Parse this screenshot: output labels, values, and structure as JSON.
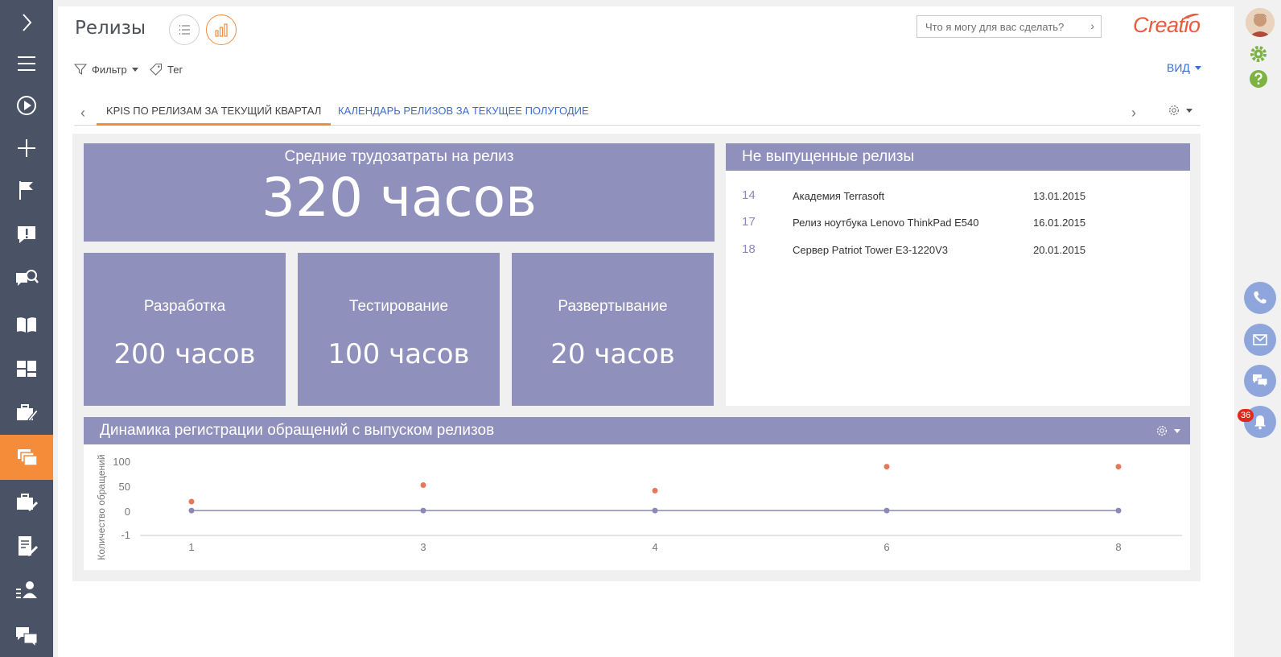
{
  "page": {
    "title": "Релизы"
  },
  "search": {
    "placeholder": "Что я могу для вас сделать?"
  },
  "logo": {
    "text": "Creatio"
  },
  "filters": {
    "filter_label": "Фильтр",
    "tag_label": "Тег"
  },
  "view_menu": {
    "label": "ВИД"
  },
  "tabs": [
    {
      "label": "KPIS ПО РЕЛИЗАМ ЗА ТЕКУЩИЙ КВАРТАЛ",
      "active": true
    },
    {
      "label": "КАЛЕНДАРЬ РЕЛИЗОВ ЗА ТЕКУЩЕЕ ПОЛУГОДИЕ",
      "active": false
    }
  ],
  "kpi": {
    "main": {
      "caption": "Средние трудозатраты на релиз",
      "value": "320 часов"
    },
    "tiles": [
      {
        "caption": "Разработка",
        "value": "200 часов"
      },
      {
        "caption": "Тестирование",
        "value": "100 часов"
      },
      {
        "caption": "Развертывание",
        "value": "20 часов"
      }
    ]
  },
  "unreleased": {
    "title": "Не выпущенные релизы",
    "rows": [
      {
        "num": "14",
        "name": "Академия Terrasoft",
        "date": "13.01.2015"
      },
      {
        "num": "17",
        "name": "Релиз ноутбука Lenovo ThinkPad E540",
        "date": "16.01.2015"
      },
      {
        "num": "18",
        "name": "Сервер Patriot Tower E3-1220V3",
        "date": "20.01.2015"
      }
    ]
  },
  "dynamics": {
    "title": "Динамика регистрации обращений с выпуском релизов"
  },
  "notifications": {
    "count": "36"
  },
  "colors": {
    "accent": "#f58c3a",
    "tile": "#9090bc",
    "nav": "#4a5366",
    "link": "#3b6ecf",
    "series_orange": "#e8775a",
    "series_purple": "#8a8ab8"
  },
  "chart_data": {
    "type": "scatter",
    "ylabel": "Количество обращений",
    "xlabel": "",
    "categories": [
      "1",
      "3",
      "4",
      "6",
      "8"
    ],
    "yticks": [
      "100",
      "50",
      "0",
      "-1"
    ],
    "ylim": [
      -1,
      100
    ],
    "series": [
      {
        "values": [
          21,
          54,
          43,
          91,
          91
        ]
      },
      {
        "values": [
          3,
          3,
          3,
          3,
          3
        ]
      }
    ]
  }
}
